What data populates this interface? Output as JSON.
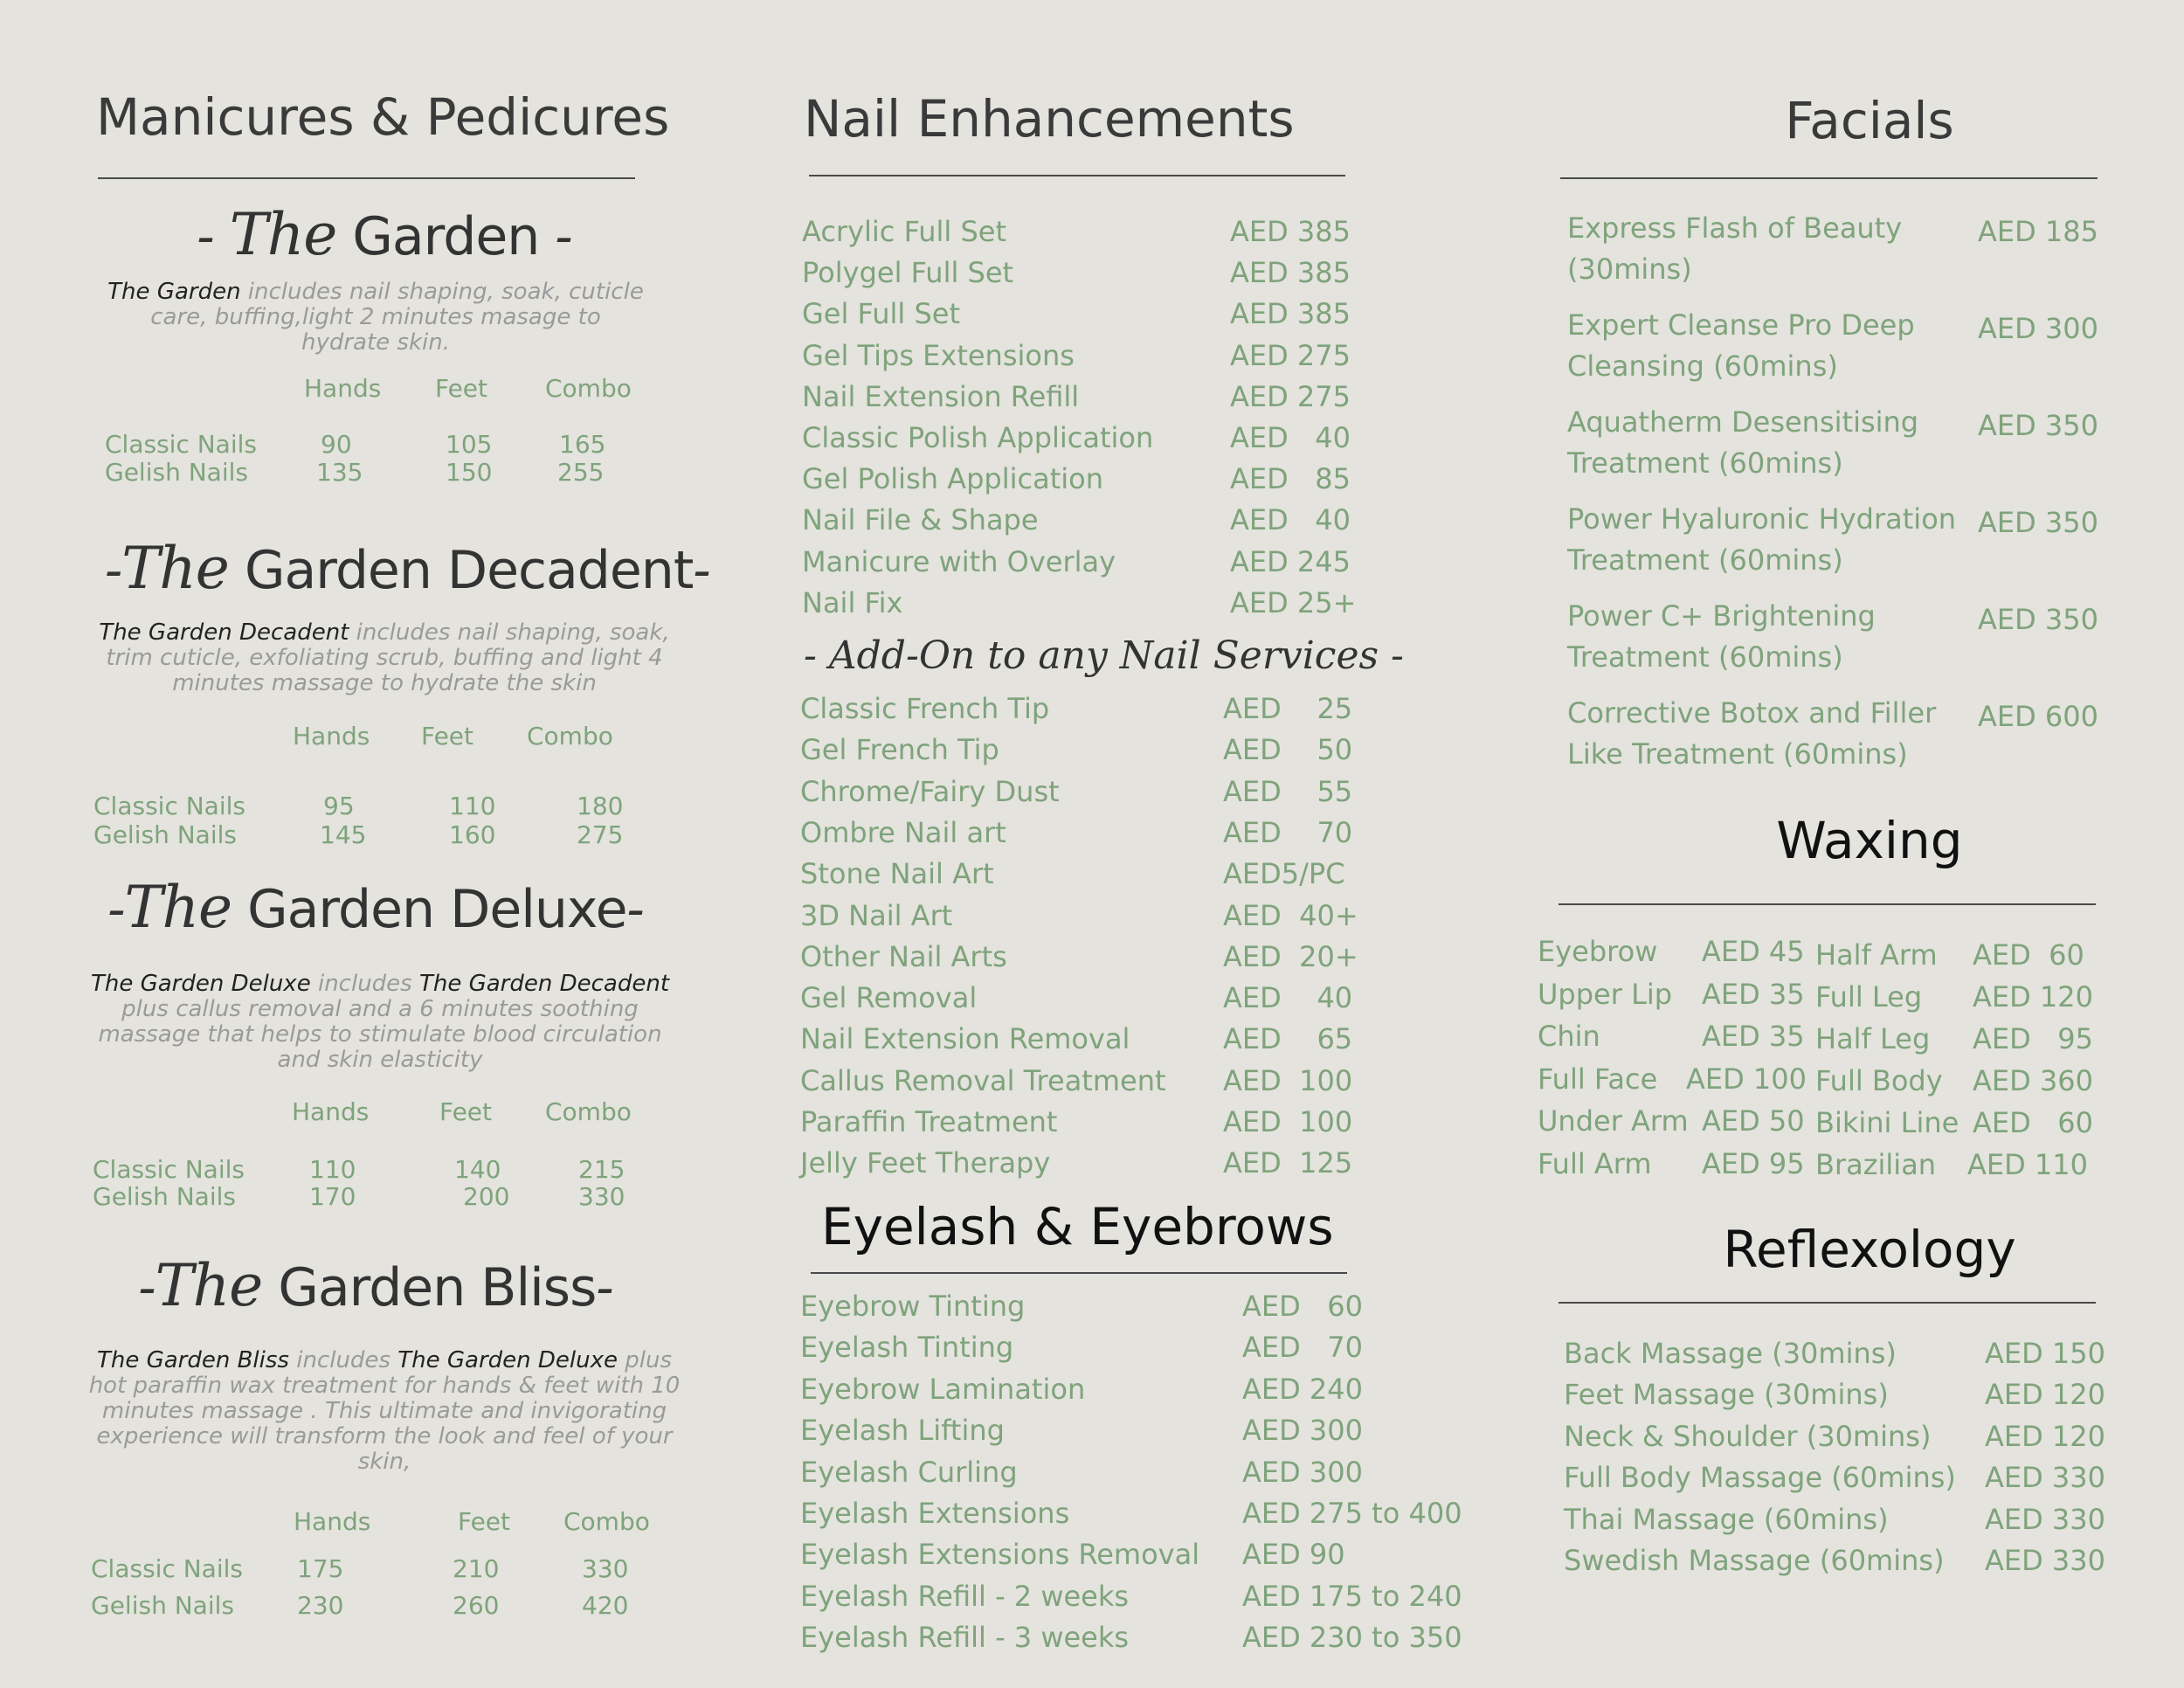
{
  "manicures": {
    "title": "Manicures & Pedicures",
    "packages": [
      {
        "the": "The",
        "name": "Garden",
        "desc_name": "The Garden",
        "desc": " includes nail shaping, soak, cuticle care, buffing,light 2 minutes masage to hydrate skin.",
        "headers": [
          "Hands",
          "Feet",
          "Combo"
        ],
        "rows": [
          {
            "label": "Classic Nails",
            "hands": "90",
            "feet": "105",
            "combo": "165"
          },
          {
            "label": "Gelish Nails",
            "hands": "135",
            "feet": "150",
            "combo": "255"
          }
        ]
      },
      {
        "the": "The",
        "name": "Garden Decadent",
        "desc_name": "The Garden Decadent",
        "desc": " includes nail shaping, soak, trim cuticle, exfoliating scrub, buffing and light 4 minutes massage to hydrate the skin",
        "headers": [
          "Hands",
          "Feet",
          "Combo"
        ],
        "rows": [
          {
            "label": "Classic Nails",
            "hands": "95",
            "feet": "110",
            "combo": "180"
          },
          {
            "label": "Gelish  Nails",
            "hands": "145",
            "feet": "160",
            "combo": "275"
          }
        ]
      },
      {
        "the": "The",
        "name": "Garden Deluxe",
        "desc_name": "The Garden Deluxe",
        "desc_mid": " includes ",
        "desc_name2": "The Garden Decadent",
        "desc": " plus callus removal and a 6 minutes soothing massage that helps to stimulate blood circulation and skin elasticity",
        "headers": [
          "Hands",
          "Feet",
          "Combo"
        ],
        "rows": [
          {
            "label": "Classic Nails",
            "hands": "110",
            "feet": "140",
            "combo": "215"
          },
          {
            "label": "Gelish Nails",
            "hands": "170",
            "feet": "200",
            "combo": "330"
          }
        ]
      },
      {
        "the": "The",
        "name": "Garden Bliss",
        "desc_name": "The Garden Bliss",
        "desc_mid": "  includes ",
        "desc_name2": "The Garden Deluxe",
        "desc": " plus hot paraffin wax treatment for hands & feet with 10 minutes massage . This ultimate and invigorating experience will transform the look and feel of your skin,",
        "headers": [
          "Hands",
          "Feet",
          "Combo"
        ],
        "rows": [
          {
            "label": "Classic Nails",
            "hands": "175",
            "feet": "210",
            "combo": "330"
          },
          {
            "label": "Gelish Nails",
            "hands": "230",
            "feet": "260",
            "combo": "420"
          }
        ]
      }
    ]
  },
  "nails": {
    "title": "Nail Enhancements",
    "items": [
      {
        "name": "Acrylic Full Set",
        "price": "AED 385"
      },
      {
        "name": "Polygel Full Set",
        "price": "AED 385"
      },
      {
        "name": "Gel Full Set",
        "price": "AED 385"
      },
      {
        "name": "Gel Tips Extensions",
        "price": "AED 275"
      },
      {
        "name": "Nail Extension Refill",
        "price": "AED 275"
      },
      {
        "name": "Classic Polish Application",
        "price": "AED   40"
      },
      {
        "name": "Gel Polish Application",
        "price": "AED   85"
      },
      {
        "name": "Nail File & Shape",
        "price": "AED   40"
      },
      {
        "name": "Manicure with Overlay",
        "price": "AED 245"
      },
      {
        "name": "Nail Fix",
        "price": "AED 25+"
      }
    ],
    "addon_title": "- Add-On to any Nail Services -",
    "addons": [
      {
        "name": "Classic French Tip",
        "price": "AED    25"
      },
      {
        "name": "Gel French Tip",
        "price": "AED    50"
      },
      {
        "name": "Chrome/Fairy Dust",
        "price": "AED    55"
      },
      {
        "name": "Ombre Nail art",
        "price": "AED    70"
      },
      {
        "name": "Stone Nail Art",
        "price": "AED5/PC"
      },
      {
        "name": "3D Nail Art",
        "price": "AED  40+"
      },
      {
        "name": "Other Nail Arts",
        "price": "AED  20+"
      },
      {
        "name": "Gel Removal",
        "price": "AED    40"
      },
      {
        "name": "Nail Extension Removal",
        "price": "AED    65"
      },
      {
        "name": "Callus Removal Treatment",
        "price": "AED  100"
      },
      {
        "name": "Paraffin Treatment",
        "price": "AED  100"
      },
      {
        "name": "Jelly Feet Therapy",
        "price": "AED  125"
      }
    ]
  },
  "eyelash": {
    "title": "Eyelash & Eyebrows",
    "items": [
      {
        "name": "Eyebrow Tinting",
        "price": "AED   60"
      },
      {
        "name": "Eyelash Tinting",
        "price": "AED   70"
      },
      {
        "name": "Eyebrow Lamination",
        "price": "AED 240"
      },
      {
        "name": "Eyelash Lifting",
        "price": "AED 300"
      },
      {
        "name": "Eyelash Curling",
        "price": "AED 300"
      },
      {
        "name": "Eyelash Extensions",
        "price": "AED 275 to 400"
      },
      {
        "name": "Eyelash Extensions Removal",
        "price": "AED 90"
      },
      {
        "name": "Eyelash Refill - 2 weeks",
        "price": "AED 175 to 240"
      },
      {
        "name": "Eyelash Refill - 3 weeks",
        "price": "AED 230 to 350"
      }
    ]
  },
  "facials": {
    "title": "Facials",
    "items": [
      {
        "name": "Express Flash of Beauty (30mins)",
        "price": "AED 185"
      },
      {
        "name": "Expert Cleanse Pro Deep Cleansing (60mins)",
        "price": "AED 300"
      },
      {
        "name": "Aquatherm Desensitising Treatment (60mins)",
        "price": "AED 350"
      },
      {
        "name": "Power Hyaluronic Hydration Treatment (60mins)",
        "price": "AED 350"
      },
      {
        "name": "Power C+ Brightening Treatment (60mins)",
        "price": "AED 350"
      },
      {
        "name": "Corrective Botox and Filler Like Treatment (60mins)",
        "price": "AED 600"
      }
    ]
  },
  "waxing": {
    "title": "Waxing",
    "left": [
      {
        "name": "Eyebrow",
        "price": "AED 45"
      },
      {
        "name": "Upper Lip",
        "price": "AED 35"
      },
      {
        "name": "Chin",
        "price": "AED 35"
      },
      {
        "name": "Full Face",
        "price": "AED 100"
      },
      {
        "name": "Under Arm",
        "price": "AED 50"
      },
      {
        "name": "Full Arm",
        "price": "AED 95"
      }
    ],
    "right": [
      {
        "name": "Half Arm",
        "price": "AED  60"
      },
      {
        "name": "Full Leg",
        "price": "AED 120"
      },
      {
        "name": "Half Leg",
        "price": "AED   95"
      },
      {
        "name": "Full Body",
        "price": "AED 360"
      },
      {
        "name": "Bikini Line",
        "price": "AED   60"
      },
      {
        "name": "Brazilian",
        "price": "AED 110"
      }
    ]
  },
  "reflexology": {
    "title": "Reflexology",
    "items": [
      {
        "name": "Back Massage (30mins)",
        "price": "AED 150"
      },
      {
        "name": "Feet Massage (30mins)",
        "price": "AED 120"
      },
      {
        "name": "Neck & Shoulder (30mins)",
        "price": "AED 120"
      },
      {
        "name": "Full Body Massage (60mins)",
        "price": "AED 330"
      },
      {
        "name": "Thai Massage (60mins)",
        "price": "AED 330"
      },
      {
        "name": "Swedish Massage (60mins)",
        "price": "AED 330"
      }
    ]
  }
}
